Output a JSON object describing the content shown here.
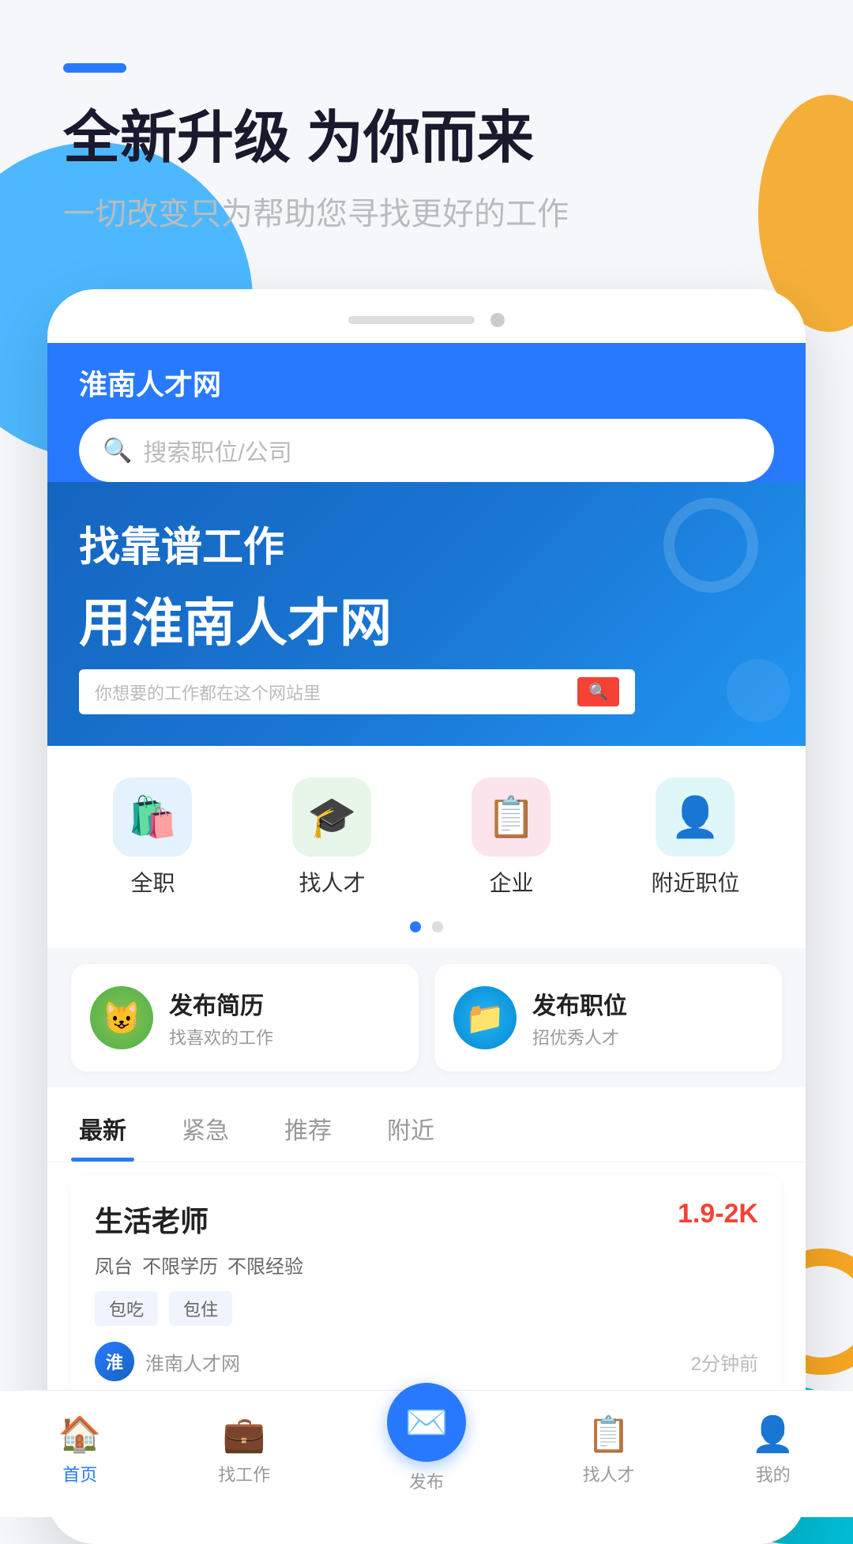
{
  "app": {
    "name": "淮南人才网"
  },
  "header": {
    "title": "全新升级 为你而来",
    "subtitle": "一切改变只为帮助您寻找更好的工作",
    "dash_color": "#2979ff"
  },
  "phone": {
    "app_title": "淮南人才网",
    "search_placeholder": "搜索职位/公司"
  },
  "banner": {
    "line1": "找靠谱工作",
    "line2": "用淮南人才网",
    "sub": "你想要的工作都在这个网站里"
  },
  "icon_grid": {
    "items": [
      {
        "label": "全职",
        "icon": "🛍️",
        "color_class": "icon-blue"
      },
      {
        "label": "找人才",
        "icon": "🎓",
        "color_class": "icon-green"
      },
      {
        "label": "企业",
        "icon": "📋",
        "color_class": "icon-red"
      },
      {
        "label": "附近职位",
        "icon": "👤",
        "color_class": "icon-teal"
      }
    ]
  },
  "quick_actions": [
    {
      "id": "resume",
      "title": "发布简历",
      "subtitle": "找喜欢的工作",
      "icon": "😺",
      "color_class": "qa-green"
    },
    {
      "id": "job",
      "title": "发布职位",
      "subtitle": "招优秀人才",
      "icon": "📁",
      "color_class": "qa-blue"
    }
  ],
  "tabs": [
    {
      "label": "最新",
      "active": true
    },
    {
      "label": "紧急",
      "active": false
    },
    {
      "label": "推荐",
      "active": false
    },
    {
      "label": "附近",
      "active": false
    }
  ],
  "job_card": {
    "title": "生活老师",
    "salary": "1.9-2K",
    "tags": [
      "凤台",
      "不限学历",
      "不限经验"
    ],
    "benefits": [
      "包吃",
      "包住"
    ],
    "company": "淮南人才网",
    "post_time": "2分钟前"
  },
  "bottom_nav": {
    "items": [
      {
        "label": "首页",
        "icon": "🏠",
        "active": true
      },
      {
        "label": "找工作",
        "icon": "💼",
        "active": false
      },
      {
        "label": "发布",
        "icon": "✉️",
        "active": false,
        "is_publish": true
      },
      {
        "label": "找人才",
        "icon": "📋",
        "active": false
      },
      {
        "label": "我的",
        "icon": "👤",
        "active": false
      }
    ]
  }
}
